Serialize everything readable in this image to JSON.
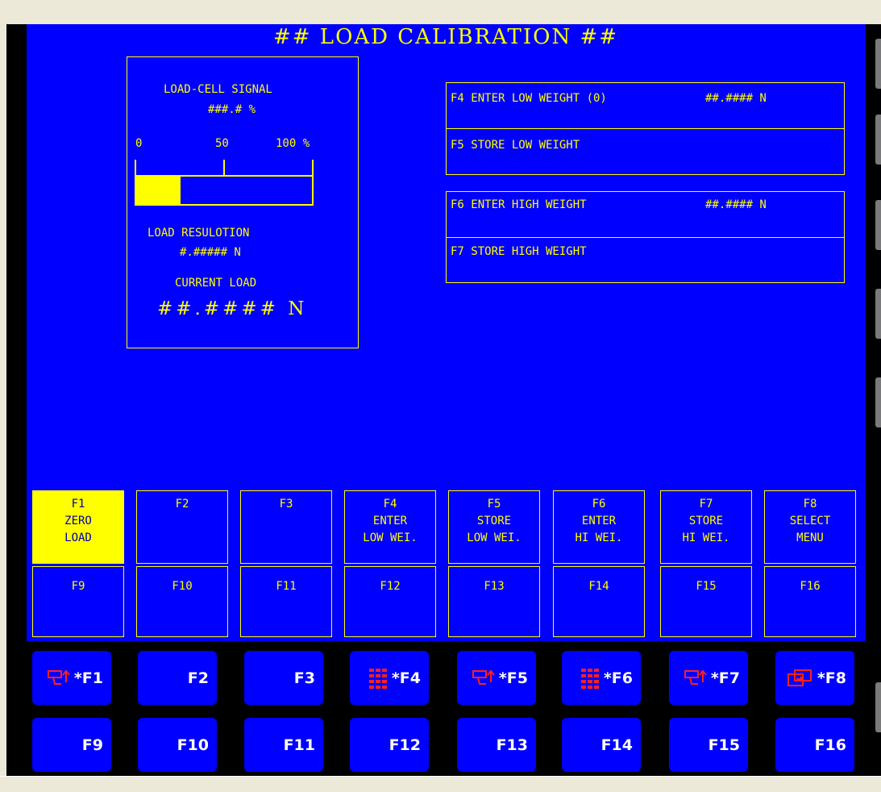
{
  "screen": {
    "title": "## LOAD CALIBRATION ##",
    "signal_label": "LOAD-CELL SIGNAL",
    "signal_value": "###.# %",
    "scale": [
      "0",
      "50",
      "100 %"
    ],
    "signal_fraction": 0.25,
    "resolution_label": "LOAD RESULOTION",
    "resolution_value": "#.##### N",
    "current_load_label": "CURRENT LOAD",
    "current_load_value": "##.#### N",
    "low": {
      "enter_label": "F4 ENTER LOW WEIGHT (0)",
      "enter_value": "##.#### N",
      "store_label": "F5 STORE LOW WEIGHT"
    },
    "high": {
      "enter_label": "F6 ENTER HIGH WEIGHT",
      "enter_value": "##.#### N",
      "store_label": "F7 STORE HIGH WEIGHT"
    }
  },
  "softkeys_row1": [
    {
      "text": "F1\nZERO\nLOAD",
      "active": true
    },
    {
      "text": "F2",
      "active": false
    },
    {
      "text": "F3",
      "active": false
    },
    {
      "text": "F4\nENTER\nLOW WEI.",
      "active": false
    },
    {
      "text": "F5\nSTORE\nLOW WEI.",
      "active": false
    },
    {
      "text": "F6\nENTER\nHI WEI.",
      "active": false
    },
    {
      "text": "F7\nSTORE\nHI WEI.",
      "active": false
    },
    {
      "text": "F8\nSELECT\nMENU",
      "active": false
    }
  ],
  "softkeys_row2": [
    "F9",
    "F10",
    "F11",
    "F12",
    "F13",
    "F14",
    "F15",
    "F16"
  ],
  "hw_keys_row1": [
    {
      "label": "*F1",
      "icon": "store-icon"
    },
    {
      "label": "F2",
      "icon": ""
    },
    {
      "label": "F3",
      "icon": ""
    },
    {
      "label": "*F4",
      "icon": "keypad-icon"
    },
    {
      "label": "*F5",
      "icon": "store-icon"
    },
    {
      "label": "*F6",
      "icon": "keypad-icon"
    },
    {
      "label": "*F7",
      "icon": "store-icon"
    },
    {
      "label": "*F8",
      "icon": "menu-icon"
    }
  ],
  "hw_keys_row2": [
    "F9",
    "F10",
    "F11",
    "F12",
    "F13",
    "F14",
    "F15",
    "F16"
  ],
  "colors": {
    "screen": "#0000ff",
    "text": "#ffff00",
    "key": "#0000ff",
    "icon": "#ff2020"
  }
}
